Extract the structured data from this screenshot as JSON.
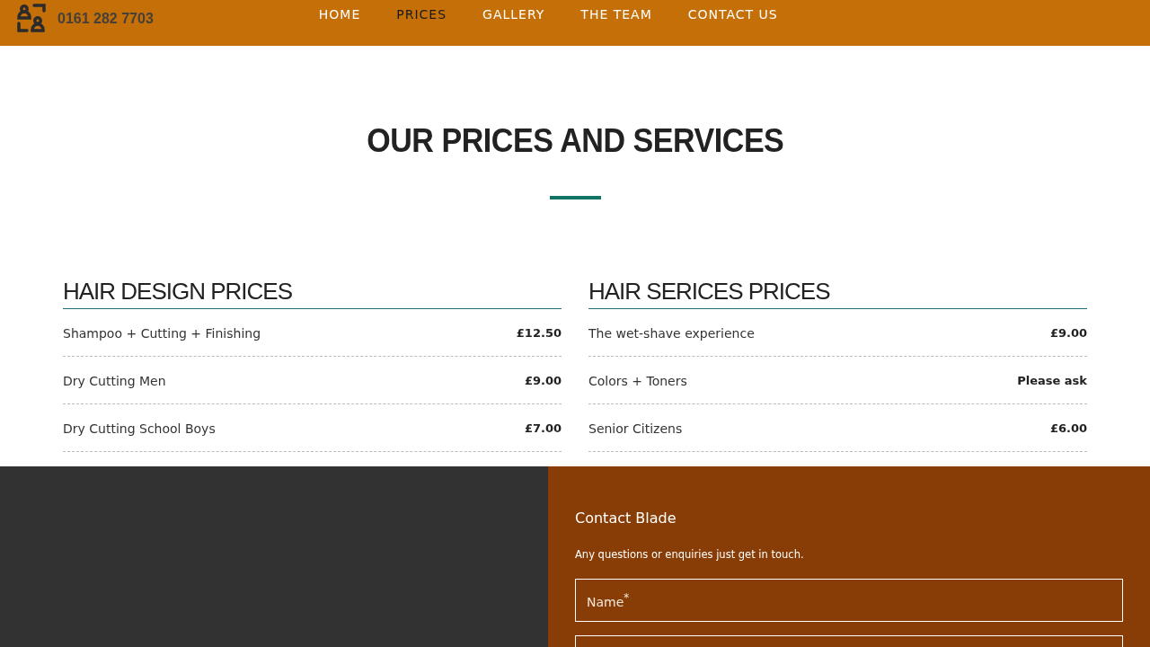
{
  "header": {
    "phone": "0161 282 7703",
    "nav": [
      {
        "label": "HOME",
        "selected": false
      },
      {
        "label": "PRICES",
        "selected": true
      },
      {
        "label": "GALLERY",
        "selected": false
      },
      {
        "label": "THE TEAM",
        "selected": false
      },
      {
        "label": "CONTACT US",
        "selected": false
      }
    ]
  },
  "page_title": "OUR PRICES AND SERVICES",
  "price_lists": [
    {
      "title": "HAIR DESIGN PRICES",
      "items": [
        {
          "service": "Shampoo + Cutting + Finishing",
          "price": "£12.50"
        },
        {
          "service": "Dry Cutting Men",
          "price": "£9.00"
        },
        {
          "service": "Dry Cutting School Boys",
          "price": "£7.00"
        }
      ]
    },
    {
      "title": "HAIR SERICES PRICES",
      "items": [
        {
          "service": "The wet-shave experience",
          "price": "£9.00"
        },
        {
          "service": "Colors + Toners",
          "price": "Please ask"
        },
        {
          "service": "Senior Citizens",
          "price": "£6.00"
        }
      ]
    }
  ],
  "contact": {
    "title": "Contact Blade",
    "text": "Any questions or enquiries just get in touch.",
    "fields": [
      {
        "kind": "text",
        "placeholder": "Name$^{*}$"
      },
      {
        "kind": "text"
      }
    ]
  }
}
